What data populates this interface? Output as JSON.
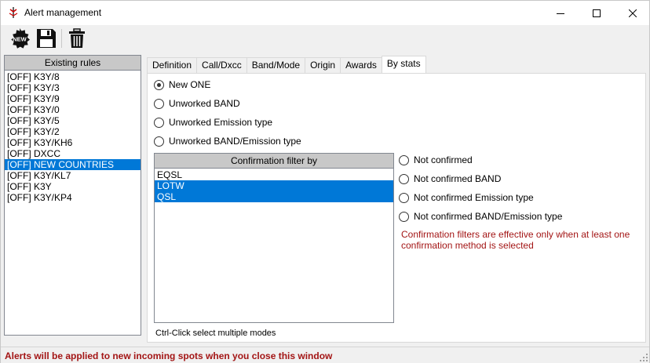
{
  "window": {
    "title": "Alert management"
  },
  "toolbar": {
    "new_label": "NEW"
  },
  "rules": {
    "header": "Existing rules",
    "items": [
      {
        "label": "[OFF] K3Y/8",
        "selected": false
      },
      {
        "label": "[OFF] K3Y/3",
        "selected": false
      },
      {
        "label": "[OFF] K3Y/9",
        "selected": false
      },
      {
        "label": "[OFF] K3Y/0",
        "selected": false
      },
      {
        "label": "[OFF] K3Y/5",
        "selected": false
      },
      {
        "label": "[OFF] K3Y/2",
        "selected": false
      },
      {
        "label": "[OFF] K3Y/KH6",
        "selected": false
      },
      {
        "label": "[OFF] DXCC",
        "selected": false
      },
      {
        "label": "[OFF] NEW COUNTRIES",
        "selected": true
      },
      {
        "label": "[OFF] K3Y/KL7",
        "selected": false
      },
      {
        "label": "[OFF] K3Y",
        "selected": false
      },
      {
        "label": "[OFF] K3Y/KP4",
        "selected": false
      }
    ]
  },
  "tabs": [
    {
      "label": "Definition",
      "active": false
    },
    {
      "label": "Call/Dxcc",
      "active": false
    },
    {
      "label": "Band/Mode",
      "active": false
    },
    {
      "label": "Origin",
      "active": false
    },
    {
      "label": "Awards",
      "active": false
    },
    {
      "label": "By stats",
      "active": true
    }
  ],
  "stats": {
    "options": [
      {
        "label": "New ONE",
        "checked": true
      },
      {
        "label": "Unworked BAND",
        "checked": false
      },
      {
        "label": "Unworked Emission type",
        "checked": false
      },
      {
        "label": "Unworked BAND/Emission type",
        "checked": false
      }
    ],
    "confirmation": {
      "header": "Confirmation filter by",
      "items": [
        {
          "label": "EQSL",
          "selected": false
        },
        {
          "label": "LOTW",
          "selected": true
        },
        {
          "label": "QSL",
          "selected": true
        }
      ],
      "hint": "Ctrl-Click select multiple modes"
    },
    "not_confirmed_options": [
      {
        "label": "Not confirmed",
        "checked": false
      },
      {
        "label": "Not confirmed BAND",
        "checked": false
      },
      {
        "label": "Not confirmed Emission type",
        "checked": false
      },
      {
        "label": "Not confirmed BAND/Emission type",
        "checked": false
      }
    ],
    "note": "Confirmation filters are effective only when at least one confirmation method is selected"
  },
  "status": {
    "text": "Alerts will be applied to new incoming spots when you close this window"
  },
  "colors": {
    "selection": "#0078d7",
    "warning_text": "#a31515",
    "header_bg": "#c8c8c8"
  },
  "icons": [
    "app-icon",
    "minimize-icon",
    "maximize-icon",
    "close-icon",
    "new-rule-icon",
    "save-icon",
    "trash-icon",
    "resize-grip-icon"
  ]
}
